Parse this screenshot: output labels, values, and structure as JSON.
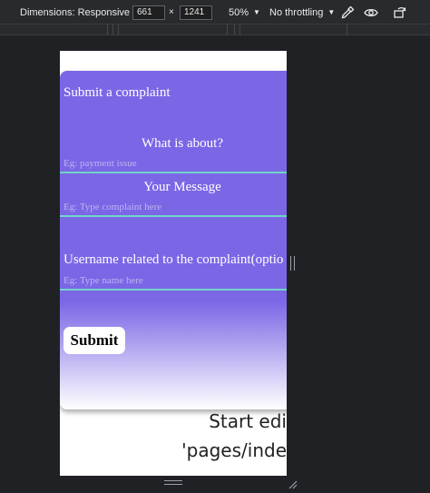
{
  "toolbar": {
    "dimensions_label": "Dimensions: Responsive",
    "width": "661",
    "times": "×",
    "height": "1241",
    "zoom": "50%",
    "throttling": "No throttling",
    "icons": [
      "eyedropper-icon",
      "eye-icon",
      "rotate-icon"
    ]
  },
  "form": {
    "title": "Submit a complaint",
    "about_label": "What is about?",
    "about_placeholder": "Eg: payment issue",
    "message_label": "Your Message",
    "message_placeholder": "Eg: Type complaint here",
    "username_label": "Username related to the complaint(optio",
    "username_placeholder": "Eg: Type name here",
    "submit_label": "Submit"
  },
  "page_text": {
    "line1": "Start edi",
    "line2": "'pages/inde"
  },
  "colors": {
    "card_purple": "#7b66e6",
    "field_underline": "#6fd6c8",
    "devtools_bg": "#202124"
  }
}
